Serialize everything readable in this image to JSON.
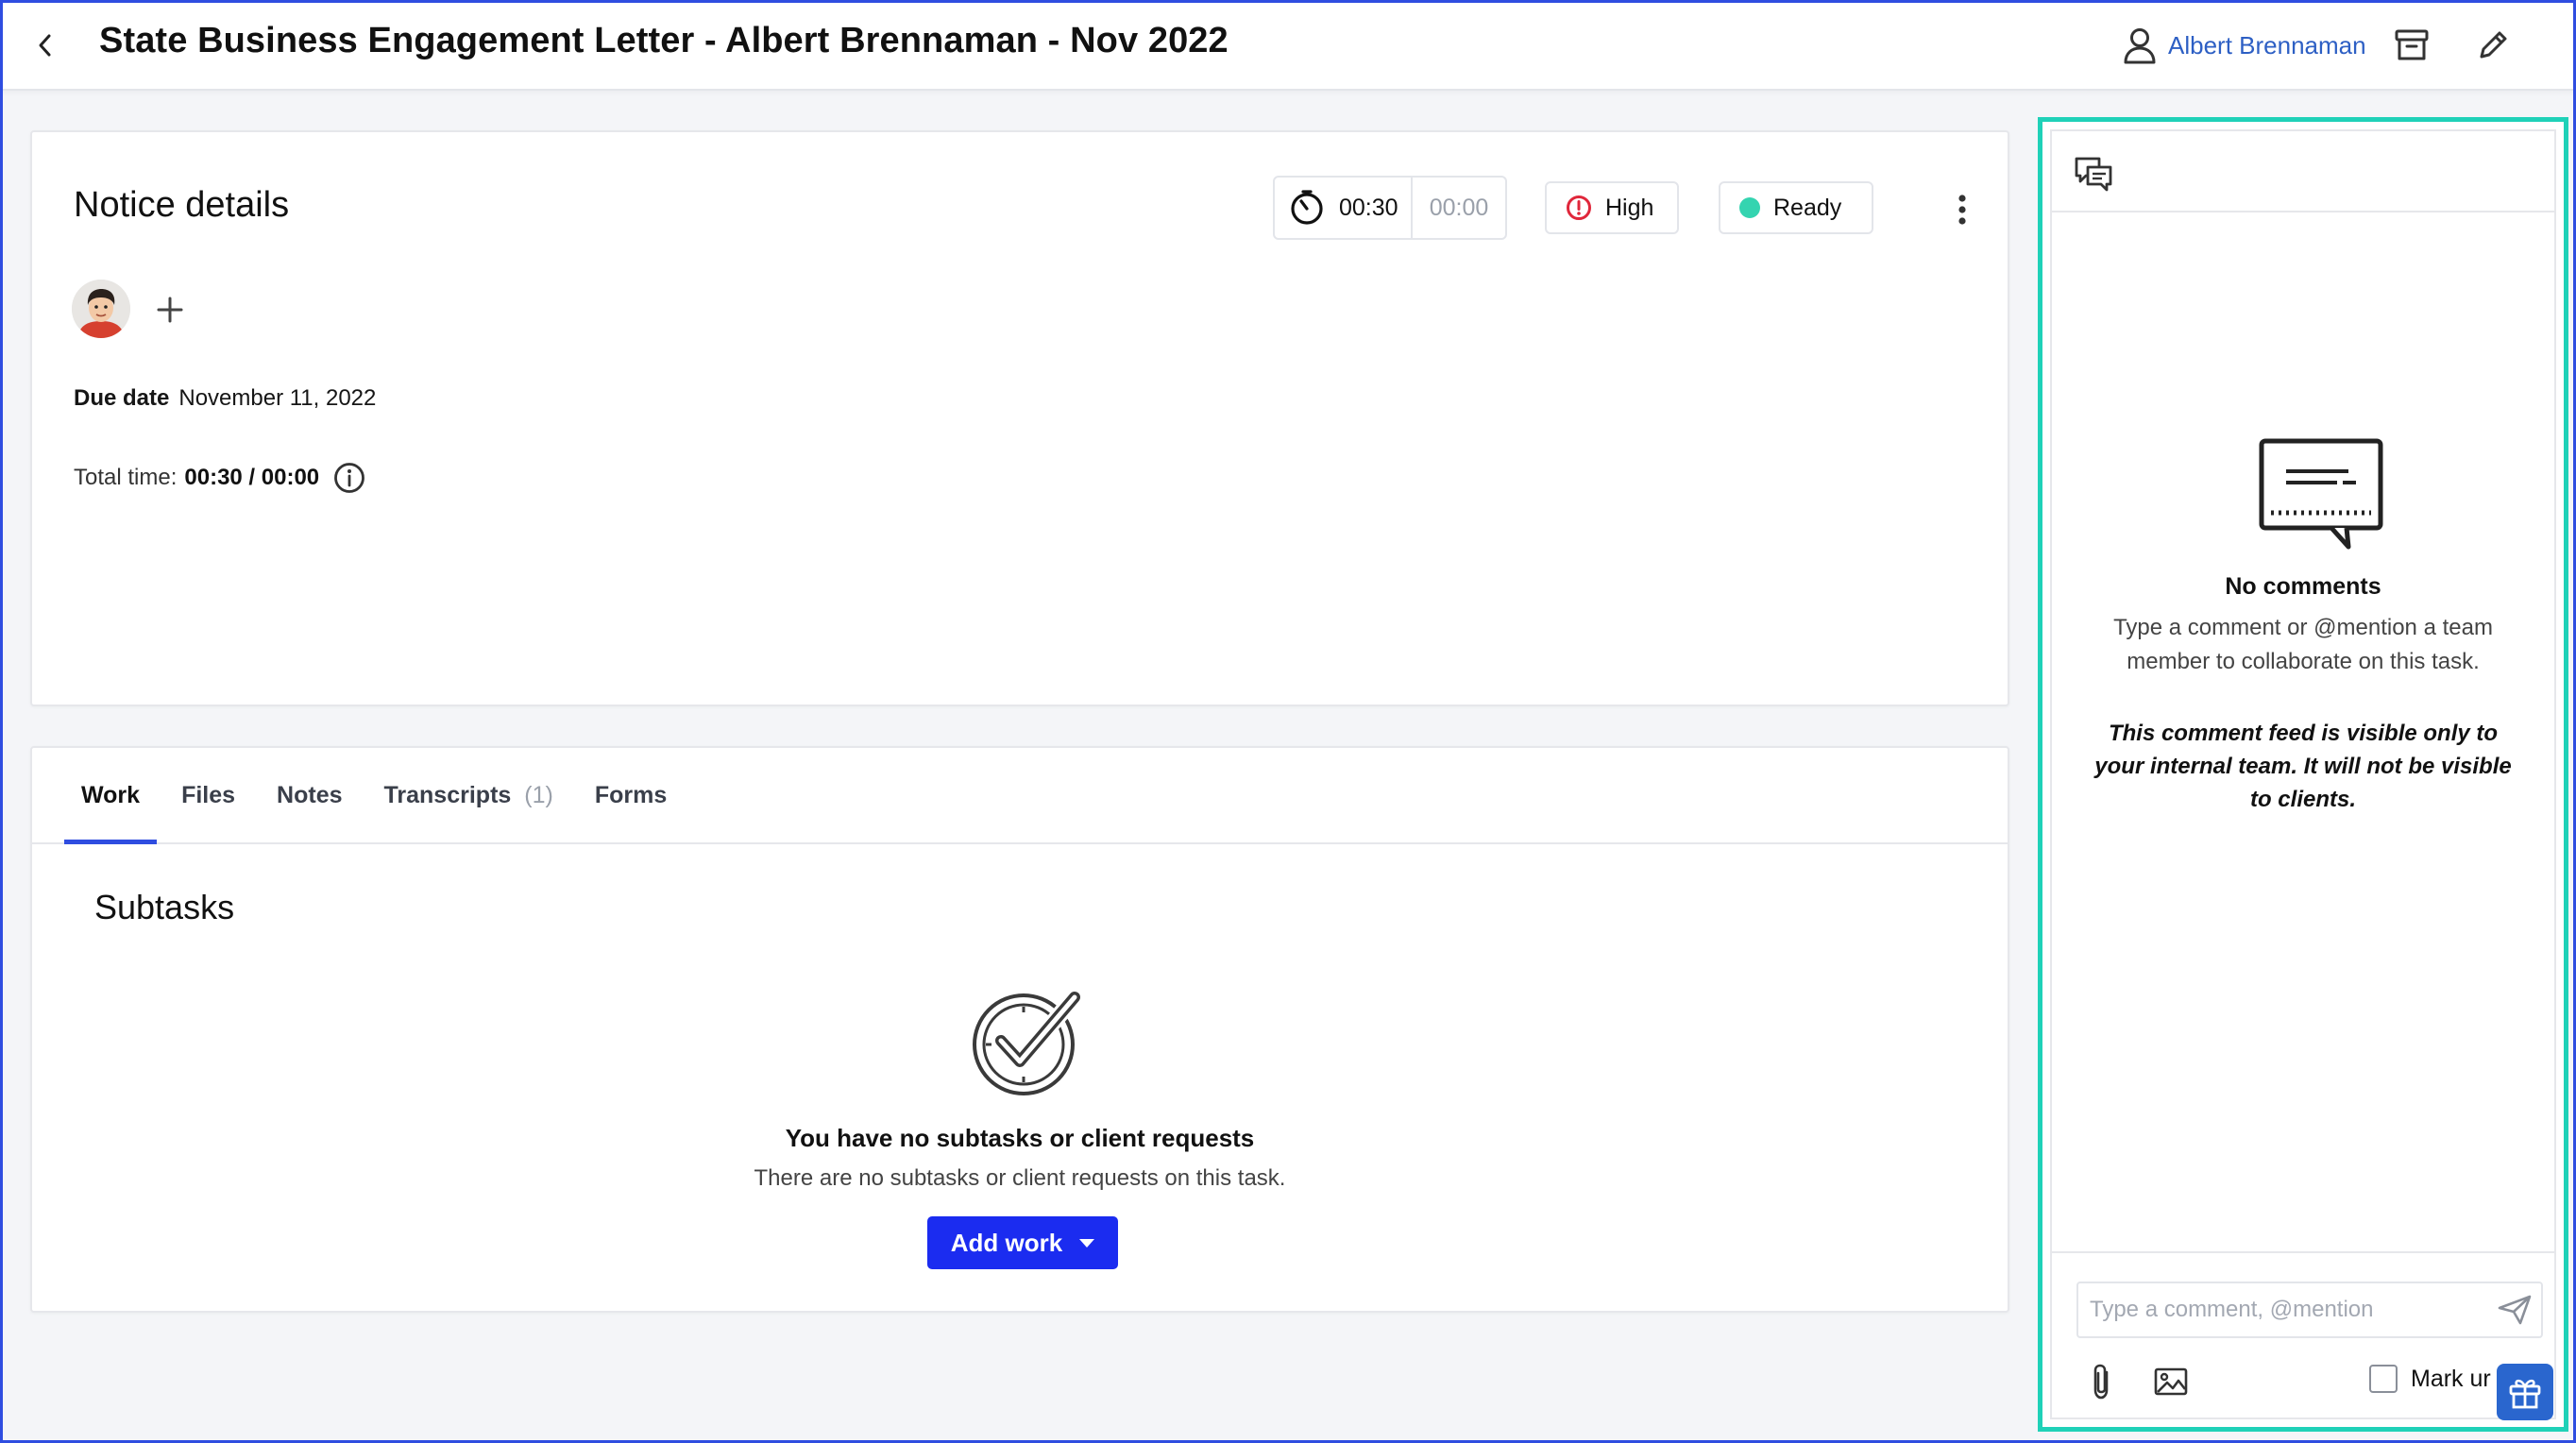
{
  "header": {
    "title": "State Business Engagement Letter - Albert Brennaman - Nov 2022",
    "assignee_name": "Albert Brennaman",
    "icons": [
      "chevron-left-icon",
      "user-icon",
      "archive-icon",
      "pencil-icon"
    ]
  },
  "notice": {
    "title": "Notice details",
    "timer": {
      "tracked": "00:30",
      "estimate": "00:00"
    },
    "priority": {
      "label": "High",
      "color": "#e0273b"
    },
    "status": {
      "label": "Ready",
      "color": "#34d4b0"
    },
    "due_date_label": "Due date",
    "due_date_value": "November 11, 2022",
    "total_time_label": "Total time:",
    "total_time_value": "00:30 / 00:00"
  },
  "work": {
    "tabs": [
      {
        "label": "Work",
        "count": ""
      },
      {
        "label": "Files",
        "count": ""
      },
      {
        "label": "Notes",
        "count": ""
      },
      {
        "label": "Transcripts",
        "count": "(1)"
      },
      {
        "label": "Forms",
        "count": ""
      }
    ],
    "active_tab": "Work",
    "subtasks_title": "Subtasks",
    "empty_heading": "You have no subtasks or client requests",
    "empty_sub": "There are no subtasks or client requests on this task.",
    "add_work_label": "Add work"
  },
  "comments": {
    "empty_title": "No comments",
    "empty_sub": "Type a comment or @mention a team member to collaborate on this task.",
    "visibility_note": "This comment feed is visible only to your internal team. It will not be visible to clients.",
    "input_placeholder": "Type a comment, @mention",
    "mark_label": "Mark ur"
  },
  "colors": {
    "accent": "#1b2cf0",
    "link": "#2d5fc4",
    "panel_highlight": "#1fd1b8",
    "frame": "#2f4de0"
  }
}
